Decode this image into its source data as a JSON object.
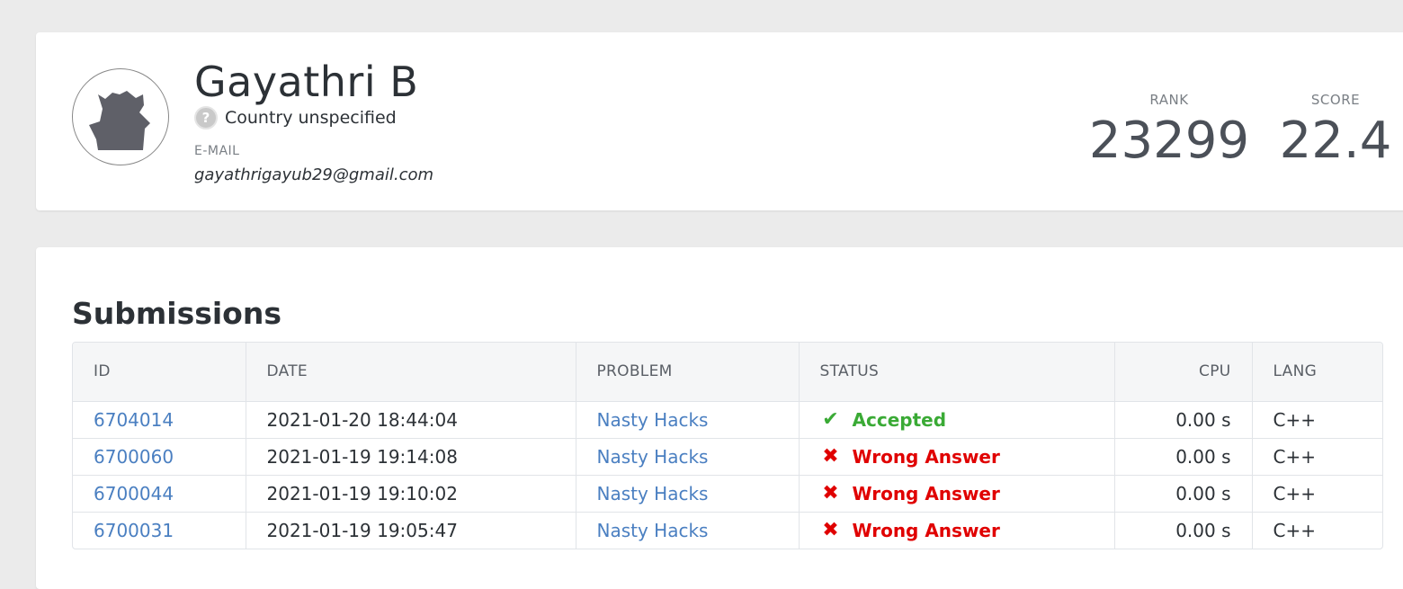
{
  "profile": {
    "name": "Gayathri B",
    "country": "Country unspecified",
    "email_label": "E-MAIL",
    "email": "gayathrigayub29@gmail.com",
    "rank_label": "RANK",
    "rank": "23299",
    "score_label": "SCORE",
    "score": "22.4"
  },
  "submissions": {
    "title": "Submissions",
    "columns": [
      "ID",
      "DATE",
      "PROBLEM",
      "STATUS",
      "CPU",
      "LANG"
    ],
    "rows": [
      {
        "id": "6704014",
        "date": "2021-01-20 18:44:04",
        "problem": "Nasty Hacks",
        "status": "Accepted",
        "cpu": "0.00 s",
        "lang": "C++"
      },
      {
        "id": "6700060",
        "date": "2021-01-19 19:14:08",
        "problem": "Nasty Hacks",
        "status": "Wrong Answer",
        "cpu": "0.00 s",
        "lang": "C++"
      },
      {
        "id": "6700044",
        "date": "2021-01-19 19:10:02",
        "problem": "Nasty Hacks",
        "status": "Wrong Answer",
        "cpu": "0.00 s",
        "lang": "C++"
      },
      {
        "id": "6700031",
        "date": "2021-01-19 19:05:47",
        "problem": "Nasty Hacks",
        "status": "Wrong Answer",
        "cpu": "0.00 s",
        "lang": "C++"
      }
    ]
  },
  "colors": {
    "accepted": "#3aaa35",
    "wrong": "#e00000",
    "link": "#4a7fc1"
  },
  "icons": {
    "accepted": "check-icon",
    "wrong": "cross-icon",
    "country": "question-icon",
    "avatar": "cat-avatar"
  }
}
